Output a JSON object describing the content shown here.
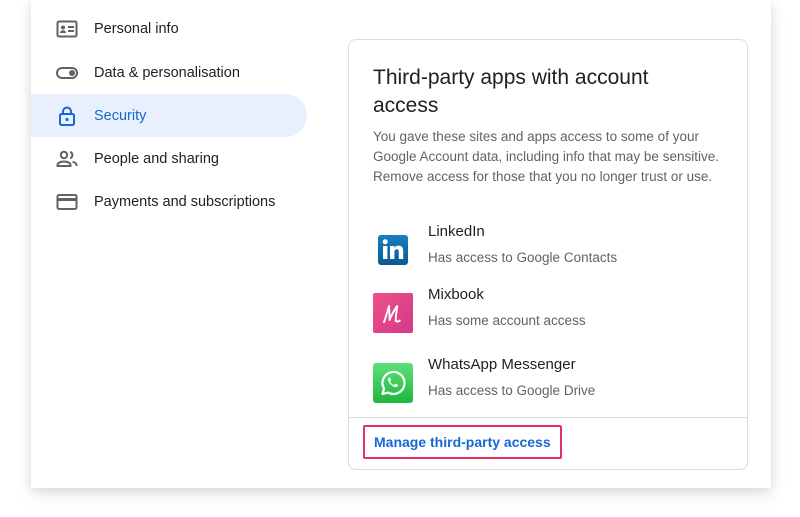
{
  "sidebar": {
    "items": [
      {
        "label": "Personal info",
        "icon": "id-card-icon",
        "active": false
      },
      {
        "label": "Data & personalisation",
        "icon": "toggle-icon",
        "active": false
      },
      {
        "label": "Security",
        "icon": "lock-icon",
        "active": true
      },
      {
        "label": "People and sharing",
        "icon": "people-icon",
        "active": false
      },
      {
        "label": "Payments and subscriptions",
        "icon": "credit-card-icon",
        "active": false
      }
    ]
  },
  "card": {
    "title": "Third-party apps with account access",
    "description": "You gave these sites and apps access to some of your Google Account data, including info that may be sensi­tive. Remove access for those that you no longer trust or use.",
    "apps": [
      {
        "name": "LinkedIn",
        "desc": "Has access to Google Contacts",
        "icon": "linkedin-logo-icon"
      },
      {
        "name": "Mixbook",
        "desc": "Has some account access",
        "icon": "mixbook-logo-icon"
      },
      {
        "name": "WhatsApp Messenger",
        "desc": "Has access to Google Drive",
        "icon": "whatsapp-logo-icon"
      }
    ],
    "manage_label": "Manage third-party access"
  },
  "colors": {
    "accent": "#1967d2",
    "active_bg": "#e8f0fe",
    "highlight": "#e0316b",
    "text_primary": "#202124",
    "text_secondary": "#5f6368",
    "divider": "#dadce0"
  }
}
